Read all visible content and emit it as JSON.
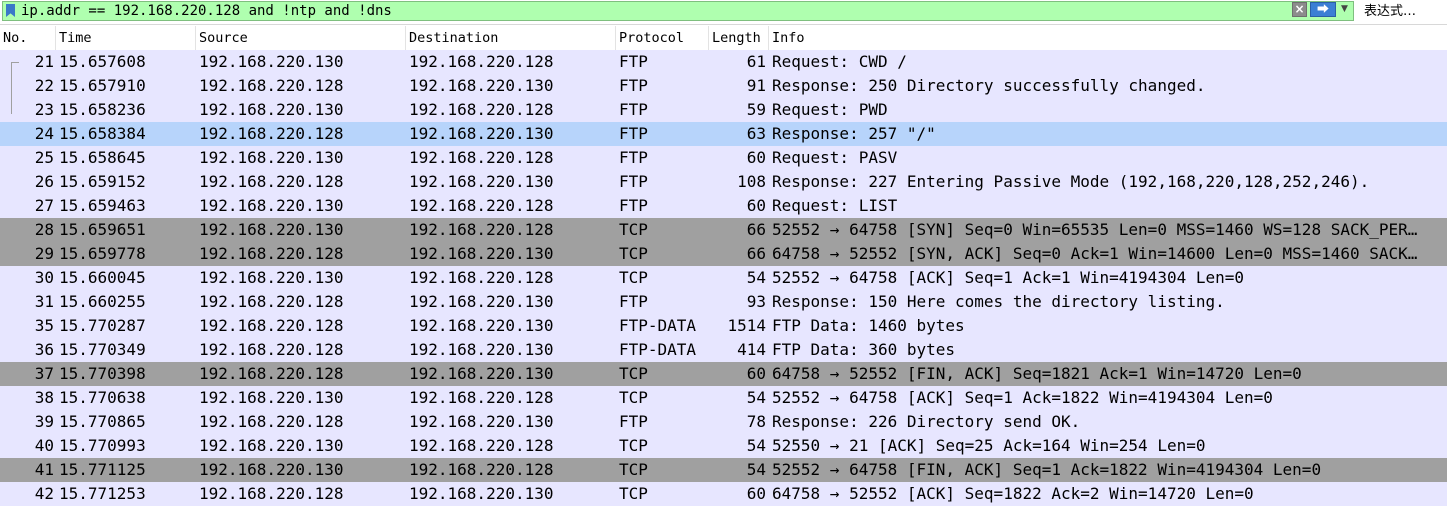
{
  "filter": {
    "text": "ip.addr == 192.168.220.128 and !ntp and !dns",
    "clear_icon": "×",
    "apply_icon": "⮕",
    "dropdown_icon": "▼",
    "expression_label": "表达式…"
  },
  "columns": [
    "No.",
    "Time",
    "Source",
    "Destination",
    "Protocol",
    "Length",
    "Info"
  ],
  "colors": {
    "ftp": "#e7e6ff",
    "tcp_flag": "#a0a0a0",
    "selected": "#b7d4fb",
    "filter_valid": "#afffaf"
  },
  "packets": [
    {
      "no": "21",
      "time": "15.657608",
      "src": "192.168.220.130",
      "dst": "192.168.220.128",
      "proto": "FTP",
      "len": "61",
      "info": "Request: CWD /",
      "style": "ftp"
    },
    {
      "no": "22",
      "time": "15.657910",
      "src": "192.168.220.128",
      "dst": "192.168.220.130",
      "proto": "FTP",
      "len": "91",
      "info": "Response: 250 Directory successfully changed.",
      "style": "ftp"
    },
    {
      "no": "23",
      "time": "15.658236",
      "src": "192.168.220.130",
      "dst": "192.168.220.128",
      "proto": "FTP",
      "len": "59",
      "info": "Request: PWD",
      "style": "ftp"
    },
    {
      "no": "24",
      "time": "15.658384",
      "src": "192.168.220.128",
      "dst": "192.168.220.130",
      "proto": "FTP",
      "len": "63",
      "info": "Response: 257 \"/\"",
      "style": "selected"
    },
    {
      "no": "25",
      "time": "15.658645",
      "src": "192.168.220.130",
      "dst": "192.168.220.128",
      "proto": "FTP",
      "len": "60",
      "info": "Request: PASV",
      "style": "ftp"
    },
    {
      "no": "26",
      "time": "15.659152",
      "src": "192.168.220.128",
      "dst": "192.168.220.130",
      "proto": "FTP",
      "len": "108",
      "info": "Response: 227 Entering Passive Mode (192,168,220,128,252,246).",
      "style": "ftp"
    },
    {
      "no": "27",
      "time": "15.659463",
      "src": "192.168.220.130",
      "dst": "192.168.220.128",
      "proto": "FTP",
      "len": "60",
      "info": "Request: LIST",
      "style": "ftp"
    },
    {
      "no": "28",
      "time": "15.659651",
      "src": "192.168.220.130",
      "dst": "192.168.220.128",
      "proto": "TCP",
      "len": "66",
      "info": "52552 → 64758 [SYN] Seq=0 Win=65535 Len=0 MSS=1460 WS=128 SACK_PER…",
      "style": "tcp_flag"
    },
    {
      "no": "29",
      "time": "15.659778",
      "src": "192.168.220.128",
      "dst": "192.168.220.130",
      "proto": "TCP",
      "len": "66",
      "info": "64758 → 52552 [SYN, ACK] Seq=0 Ack=1 Win=14600 Len=0 MSS=1460 SACK…",
      "style": "tcp_flag"
    },
    {
      "no": "30",
      "time": "15.660045",
      "src": "192.168.220.130",
      "dst": "192.168.220.128",
      "proto": "TCP",
      "len": "54",
      "info": "52552 → 64758 [ACK] Seq=1 Ack=1 Win=4194304 Len=0",
      "style": "ftp"
    },
    {
      "no": "31",
      "time": "15.660255",
      "src": "192.168.220.128",
      "dst": "192.168.220.130",
      "proto": "FTP",
      "len": "93",
      "info": "Response: 150 Here comes the directory listing.",
      "style": "ftp"
    },
    {
      "no": "35",
      "time": "15.770287",
      "src": "192.168.220.128",
      "dst": "192.168.220.130",
      "proto": "FTP-DATA",
      "len": "1514",
      "info": "FTP Data: 1460 bytes",
      "style": "ftp"
    },
    {
      "no": "36",
      "time": "15.770349",
      "src": "192.168.220.128",
      "dst": "192.168.220.130",
      "proto": "FTP-DATA",
      "len": "414",
      "info": "FTP Data: 360 bytes",
      "style": "ftp"
    },
    {
      "no": "37",
      "time": "15.770398",
      "src": "192.168.220.128",
      "dst": "192.168.220.130",
      "proto": "TCP",
      "len": "60",
      "info": "64758 → 52552 [FIN, ACK] Seq=1821 Ack=1 Win=14720 Len=0",
      "style": "tcp_flag"
    },
    {
      "no": "38",
      "time": "15.770638",
      "src": "192.168.220.130",
      "dst": "192.168.220.128",
      "proto": "TCP",
      "len": "54",
      "info": "52552 → 64758 [ACK] Seq=1 Ack=1822 Win=4194304 Len=0",
      "style": "ftp"
    },
    {
      "no": "39",
      "time": "15.770865",
      "src": "192.168.220.128",
      "dst": "192.168.220.130",
      "proto": "FTP",
      "len": "78",
      "info": "Response: 226 Directory send OK.",
      "style": "ftp"
    },
    {
      "no": "40",
      "time": "15.770993",
      "src": "192.168.220.130",
      "dst": "192.168.220.128",
      "proto": "TCP",
      "len": "54",
      "info": "52550 → 21 [ACK] Seq=25 Ack=164 Win=254 Len=0",
      "style": "ftp"
    },
    {
      "no": "41",
      "time": "15.771125",
      "src": "192.168.220.130",
      "dst": "192.168.220.128",
      "proto": "TCP",
      "len": "54",
      "info": "52552 → 64758 [FIN, ACK] Seq=1 Ack=1822 Win=4194304 Len=0",
      "style": "tcp_flag"
    },
    {
      "no": "42",
      "time": "15.771253",
      "src": "192.168.220.128",
      "dst": "192.168.220.130",
      "proto": "TCP",
      "len": "60",
      "info": "64758 → 52552 [ACK] Seq=1822 Ack=2 Win=14720 Len=0",
      "style": "ftp"
    }
  ]
}
